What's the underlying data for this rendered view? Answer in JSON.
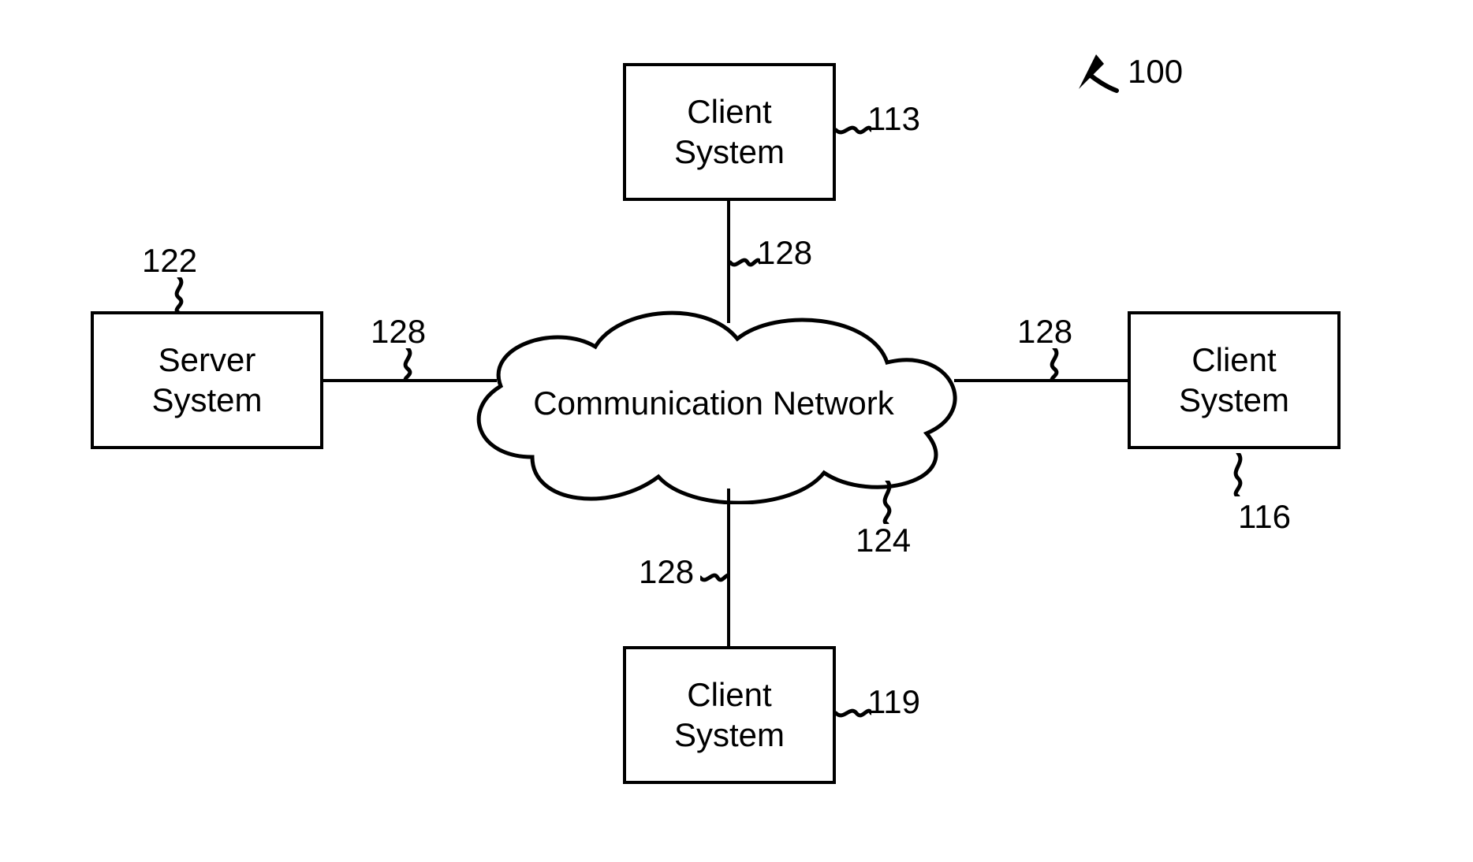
{
  "figure_ref": "100",
  "nodes": {
    "server": {
      "label": "Server System",
      "ref": "122"
    },
    "client_top": {
      "label": "Client System",
      "ref": "113"
    },
    "client_right": {
      "label": "Client System",
      "ref": "116"
    },
    "client_bottom": {
      "label": "Client System",
      "ref": "119"
    },
    "network": {
      "label": "Communication Network",
      "ref": "124"
    }
  },
  "links": {
    "left": {
      "ref": "128"
    },
    "top": {
      "ref": "128"
    },
    "right": {
      "ref": "128"
    },
    "bottom": {
      "ref": "128"
    }
  }
}
